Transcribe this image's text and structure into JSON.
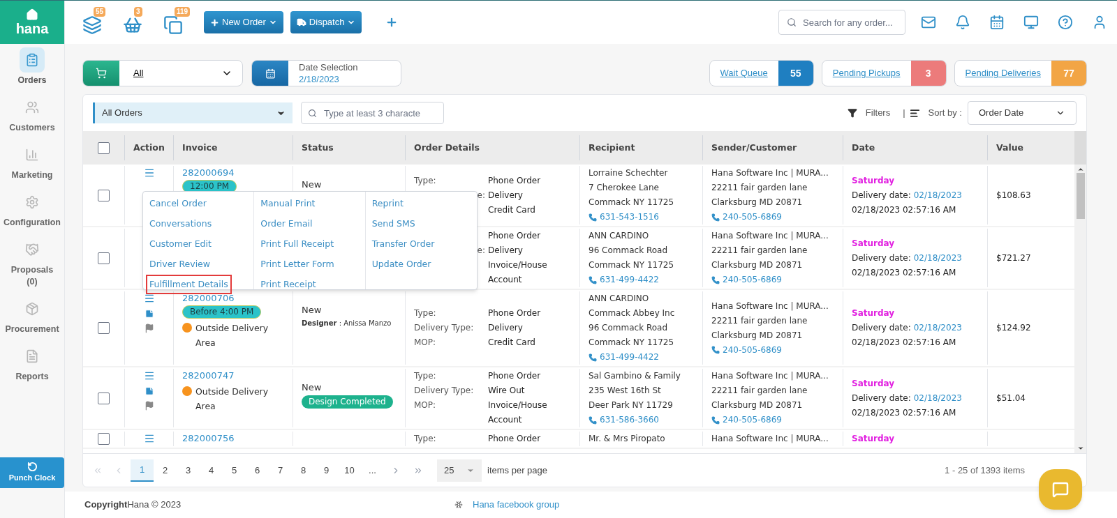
{
  "sidebar": {
    "logo": "hana",
    "items": [
      {
        "label": "Orders",
        "selected": true
      },
      {
        "label": "Customers",
        "selected": false
      },
      {
        "label": "Marketing",
        "selected": false
      },
      {
        "label": "Configuration",
        "selected": false
      },
      {
        "label": "Proposals (0)",
        "selected": false
      },
      {
        "label": "Procurement",
        "selected": false
      },
      {
        "label": "Reports",
        "selected": false
      }
    ],
    "punch_clock": "Punch Clock"
  },
  "header": {
    "counters": [
      {
        "count": "55"
      },
      {
        "count": "3"
      },
      {
        "count": "119"
      }
    ],
    "buttons": [
      {
        "label": "New Order"
      },
      {
        "label": "Dispatch"
      }
    ],
    "search_placeholder": "Search for any order..."
  },
  "filters": {
    "order_type": "All",
    "date_label": "Date Selection",
    "date_value": "2/18/2023",
    "queues": [
      {
        "label": "Wait Queue",
        "count": "55",
        "color": "#1f7fc1"
      },
      {
        "label": "Pending Pickups",
        "count": "3",
        "color": "#ec7b7b"
      },
      {
        "label": "Pending Deliveries",
        "count": "77",
        "color": "#f2a545"
      }
    ]
  },
  "toolbar": {
    "view": "All Orders",
    "search_placeholder": "Type at least 3 characte",
    "filters": "Filters",
    "separator": "|",
    "sort_label": "Sort by :",
    "sort_value": "Order Date"
  },
  "table": {
    "header_checked": false,
    "columns": [
      "Action",
      "Invoice",
      "Status",
      "Order Details",
      "Recipient",
      "Sender/Customer",
      "Date",
      "Value"
    ],
    "rows": [
      {
        "checked": false,
        "actions": [
          {
            "kind": "menu"
          }
        ],
        "invoice": "282000694",
        "time_badge": "12:00 PM",
        "status": "New",
        "details": [
          {
            "label": "Type:",
            "value": "Phone Order",
            "clipped": false
          },
          {
            "label": "e:",
            "value": "Delivery",
            "clipped": true
          },
          {
            "value": "Credit Card"
          }
        ],
        "recipient": [
          "Lorraine Schechter",
          "7 Cherokee Lane",
          "Commack NY 11725"
        ],
        "recipient_phone": "631-543-1516",
        "sender": [
          "Hana Software Inc | MURA...",
          "22211 fair garden lane",
          "Clarksburg MD 20871"
        ],
        "sender_phone": "240-505-6869",
        "day": "Saturday",
        "delivery_label": "Delivery date:",
        "delivery_date": "02/18/2023",
        "timestamp": "02/18/2023 02:57:16 AM",
        "value": "$108.63"
      },
      {
        "checked": false,
        "actions": [],
        "details": [
          {
            "value": "Phone Order"
          },
          {
            "label": "e:",
            "value": "Delivery",
            "clipped": true
          },
          {
            "value": "Invoice/House Account"
          }
        ],
        "recipient": [
          "ANN CARDINO",
          "96 Commack Road",
          "Commack NY 11725"
        ],
        "recipient_phone": "631-499-4422",
        "sender": [
          "Hana Software Inc | MURA...",
          "22211 fair garden lane",
          "Clarksburg MD 20871"
        ],
        "sender_phone": "240-505-6869",
        "day": "Saturday",
        "delivery_label": "Delivery date:",
        "delivery_date": "02/18/2023",
        "timestamp": "02/18/2023 02:57:16 AM",
        "value": "$721.27"
      },
      {
        "checked": false,
        "actions": [
          {
            "kind": "menu"
          },
          {
            "kind": "note"
          },
          {
            "kind": "flag"
          }
        ],
        "invoice": "282000706",
        "time_badge": "Before 4:00 PM",
        "area": {
          "text": "Outside Delivery Area",
          "color": "#f7931e"
        },
        "status": "New",
        "designer": "**Designer** : Anissa Manzo",
        "details": [
          {
            "label": "Type:",
            "value": "Phone Order",
            "clipped": false
          },
          {
            "label": "Delivery Type:",
            "value": "Delivery",
            "clipped": false
          },
          {
            "label": "MOP:",
            "value": "Credit Card",
            "clipped": false
          }
        ],
        "recipient": [
          "ANN CARDINO",
          "Commack Abbey Inc",
          "96 Commack Road",
          "Commack NY 11725"
        ],
        "recipient_phone": "631-499-4422",
        "sender": [
          "Hana Software Inc | MURA...",
          "22211 fair garden lane",
          "Clarksburg MD 20871"
        ],
        "sender_phone": "240-505-6869",
        "day": "Saturday",
        "delivery_label": "Delivery date:",
        "delivery_date": "02/18/2023",
        "timestamp": "02/18/2023 02:57:16 AM",
        "value": "$124.92"
      },
      {
        "checked": false,
        "actions": [
          {
            "kind": "menu"
          },
          {
            "kind": "note"
          },
          {
            "kind": "flag"
          }
        ],
        "invoice": "282000747",
        "area": {
          "text": "Outside Delivery Area",
          "color": "#f7931e"
        },
        "status": "New",
        "status_badge": "Design Completed",
        "details": [
          {
            "label": "Type:",
            "value": "Phone Order",
            "clipped": false
          },
          {
            "label": "Delivery Type:",
            "value": "Wire Out",
            "clipped": false
          },
          {
            "label": "MOP:",
            "value": "Invoice/House Account",
            "clipped": false
          }
        ],
        "recipient": [
          "Sal Gambino & Family",
          "235 West 16th St",
          "Deer Park NY 11729"
        ],
        "recipient_phone": "631-586-3660",
        "sender": [
          "Hana Software Inc | MURA...",
          "22211 fair garden lane",
          "Clarksburg MD 20871"
        ],
        "sender_phone": "240-505-6869",
        "day": "Saturday",
        "delivery_label": "Delivery date:",
        "delivery_date": "02/18/2023",
        "timestamp": "02/18/2023 02:57:16 AM",
        "value": "$51.04"
      },
      {
        "checked": false,
        "actions": [
          {
            "kind": "menu"
          }
        ],
        "invoice": "282000756",
        "details": [
          {
            "label": "Type:",
            "value": "Phone Order",
            "clipped": false
          }
        ],
        "recipient": [
          "Mr. & Mrs Piropato"
        ],
        "sender": [
          "Hana Software Inc | MURA..."
        ],
        "day": "Saturday"
      }
    ]
  },
  "action_menu": {
    "columns": [
      [
        {
          "label": "Cancel Order",
          "highlighted": false
        },
        {
          "label": "Conversations",
          "highlighted": false
        },
        {
          "label": "Customer Edit",
          "highlighted": false
        },
        {
          "label": "Driver Review",
          "highlighted": false
        },
        {
          "label": "Fulfillment Details",
          "highlighted": true
        }
      ],
      [
        {
          "label": "Manual Print",
          "highlighted": false
        },
        {
          "label": "Order Email",
          "highlighted": false
        },
        {
          "label": "Print Full Receipt",
          "highlighted": false
        },
        {
          "label": "Print Letter Form",
          "highlighted": false
        },
        {
          "label": "Print Receipt",
          "highlighted": false
        }
      ],
      [
        {
          "label": "Reprint",
          "highlighted": false
        },
        {
          "label": "Send SMS",
          "highlighted": false
        },
        {
          "label": "Transfer Order",
          "highlighted": false
        },
        {
          "label": "Update Order",
          "highlighted": false
        }
      ]
    ]
  },
  "pagination": {
    "pages": [
      {
        "label": "1",
        "selected": true
      },
      {
        "label": "2",
        "selected": false
      },
      {
        "label": "3",
        "selected": false
      },
      {
        "label": "4",
        "selected": false
      },
      {
        "label": "5",
        "selected": false
      },
      {
        "label": "6",
        "selected": false
      },
      {
        "label": "7",
        "selected": false
      },
      {
        "label": "8",
        "selected": false
      },
      {
        "label": "9",
        "selected": false
      },
      {
        "label": "10",
        "selected": false
      },
      {
        "label": "...",
        "selected": false
      }
    ],
    "per_page": "25",
    "per_page_label": "items per page",
    "summary": "1 - 25 of 1393 items"
  },
  "footer": {
    "copyright": "**Copyright**Hana © 2023",
    "link": "Hana facebook group"
  }
}
